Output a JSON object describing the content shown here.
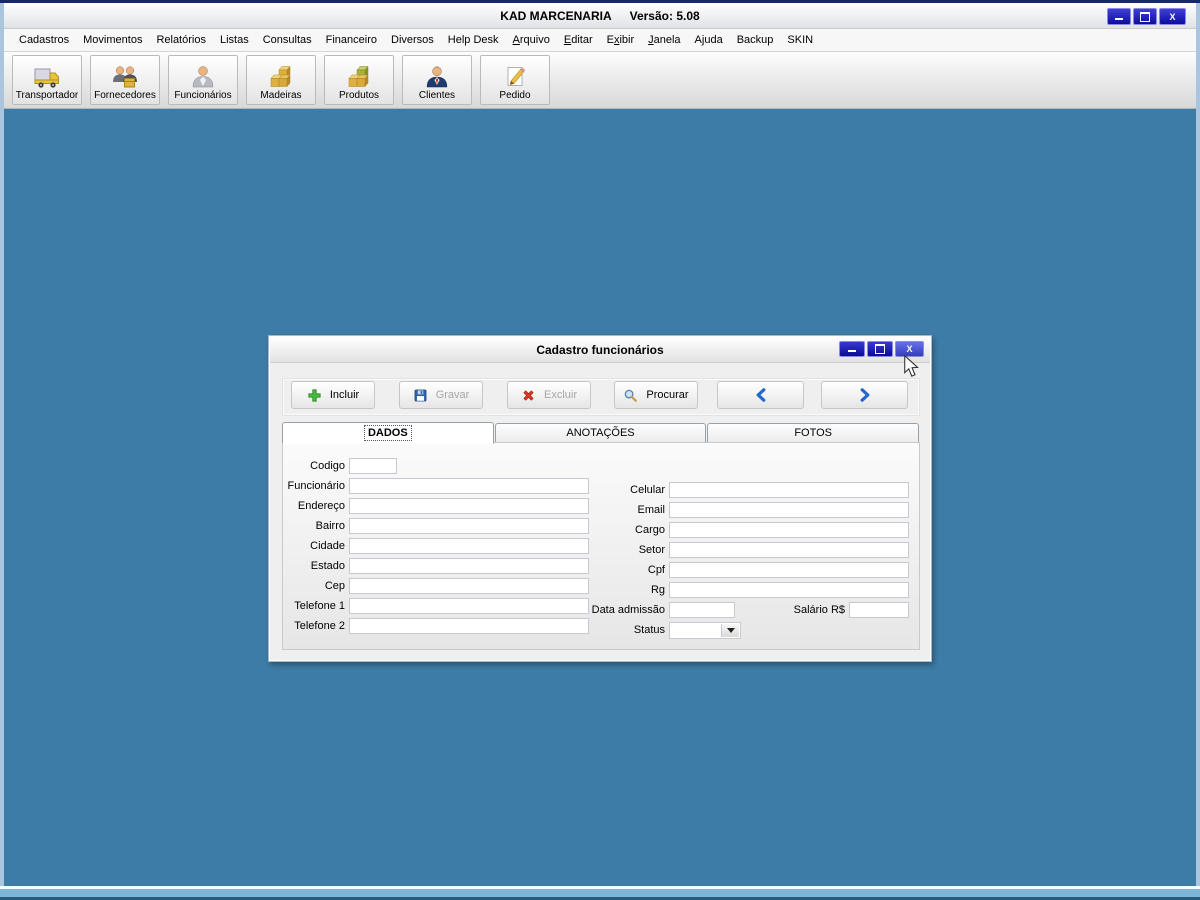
{
  "app": {
    "title": "KAD MARCENARIA",
    "version": "Versão: 5.08"
  },
  "window_controls": {
    "close_glyph": "X"
  },
  "colors": {
    "mdi_background": "#3D7CA6",
    "control_button_blue": "#1010A0",
    "accent_chevron_blue": "#2566CC",
    "plus_green": "#48BA40",
    "excluir_red": "#D83A28",
    "disabled_text": "#A6A6A6",
    "frame_light_blue": "#A9C6DE"
  },
  "menu": {
    "items": [
      {
        "pre": "Cadastros",
        "accel": "",
        "post": ""
      },
      {
        "pre": "Movimentos",
        "accel": "",
        "post": ""
      },
      {
        "pre": "Relatórios",
        "accel": "",
        "post": ""
      },
      {
        "pre": "Listas",
        "accel": "",
        "post": ""
      },
      {
        "pre": "Consultas",
        "accel": "",
        "post": ""
      },
      {
        "pre": "Financeiro",
        "accel": "",
        "post": ""
      },
      {
        "pre": "Diversos",
        "accel": "",
        "post": ""
      },
      {
        "pre": "Help Desk",
        "accel": "",
        "post": ""
      },
      {
        "pre": "",
        "accel": "A",
        "post": "rquivo"
      },
      {
        "pre": "",
        "accel": "E",
        "post": "ditar"
      },
      {
        "pre": "E",
        "accel": "x",
        "post": "ibir"
      },
      {
        "pre": "",
        "accel": "J",
        "post": "anela"
      },
      {
        "pre": "Ajuda",
        "accel": "",
        "post": ""
      },
      {
        "pre": "Backup",
        "accel": "",
        "post": ""
      },
      {
        "pre": "SKIN",
        "accel": "",
        "post": ""
      }
    ]
  },
  "toolbar": {
    "buttons": [
      {
        "label": "Transportador",
        "icon": "truck-icon"
      },
      {
        "label": "Fornecedores",
        "icon": "suppliers-icon"
      },
      {
        "label": "Funcionários",
        "icon": "employee-icon"
      },
      {
        "label": "Madeiras",
        "icon": "wood-crates-icon"
      },
      {
        "label": "Produtos",
        "icon": "products-boxes-icon"
      },
      {
        "label": "Clientes",
        "icon": "client-person-icon"
      },
      {
        "label": "Pedido",
        "icon": "order-pencil-icon"
      }
    ]
  },
  "dialog": {
    "title": "Cadastro funcionários",
    "toolbar_buttons": [
      {
        "label": "Incluir",
        "enabled": true,
        "icon": "plus-icon"
      },
      {
        "label": "Gravar",
        "enabled": false,
        "icon": "floppy-icon"
      },
      {
        "label": "Excluir",
        "enabled": false,
        "icon": "red-x-icon"
      },
      {
        "label": "Procurar",
        "enabled": true,
        "icon": "magnifier-icon"
      }
    ],
    "tabs": [
      {
        "label": "DADOS",
        "active": true
      },
      {
        "label": "ANOTAÇÕES",
        "active": false
      },
      {
        "label": "FOTOS",
        "active": false
      }
    ],
    "fields_left": [
      {
        "label": "Codigo",
        "value": ""
      },
      {
        "label": "Funcionário",
        "value": ""
      },
      {
        "label": "Endereço",
        "value": ""
      },
      {
        "label": "Bairro",
        "value": ""
      },
      {
        "label": "Cidade",
        "value": ""
      },
      {
        "label": "Estado",
        "value": ""
      },
      {
        "label": "Cep",
        "value": ""
      },
      {
        "label": "Telefone 1",
        "value": ""
      },
      {
        "label": "Telefone 2",
        "value": ""
      }
    ],
    "fields_right": [
      {
        "label": "Celular",
        "value": ""
      },
      {
        "label": "Email",
        "value": ""
      },
      {
        "label": "Cargo",
        "value": ""
      },
      {
        "label": "Setor",
        "value": ""
      },
      {
        "label": "Cpf",
        "value": ""
      },
      {
        "label": "Rg",
        "value": ""
      },
      {
        "label": "Data admissão",
        "value": ""
      },
      {
        "label": "Status",
        "value": ""
      }
    ],
    "salario": {
      "label": "Salário R$",
      "value": ""
    }
  }
}
